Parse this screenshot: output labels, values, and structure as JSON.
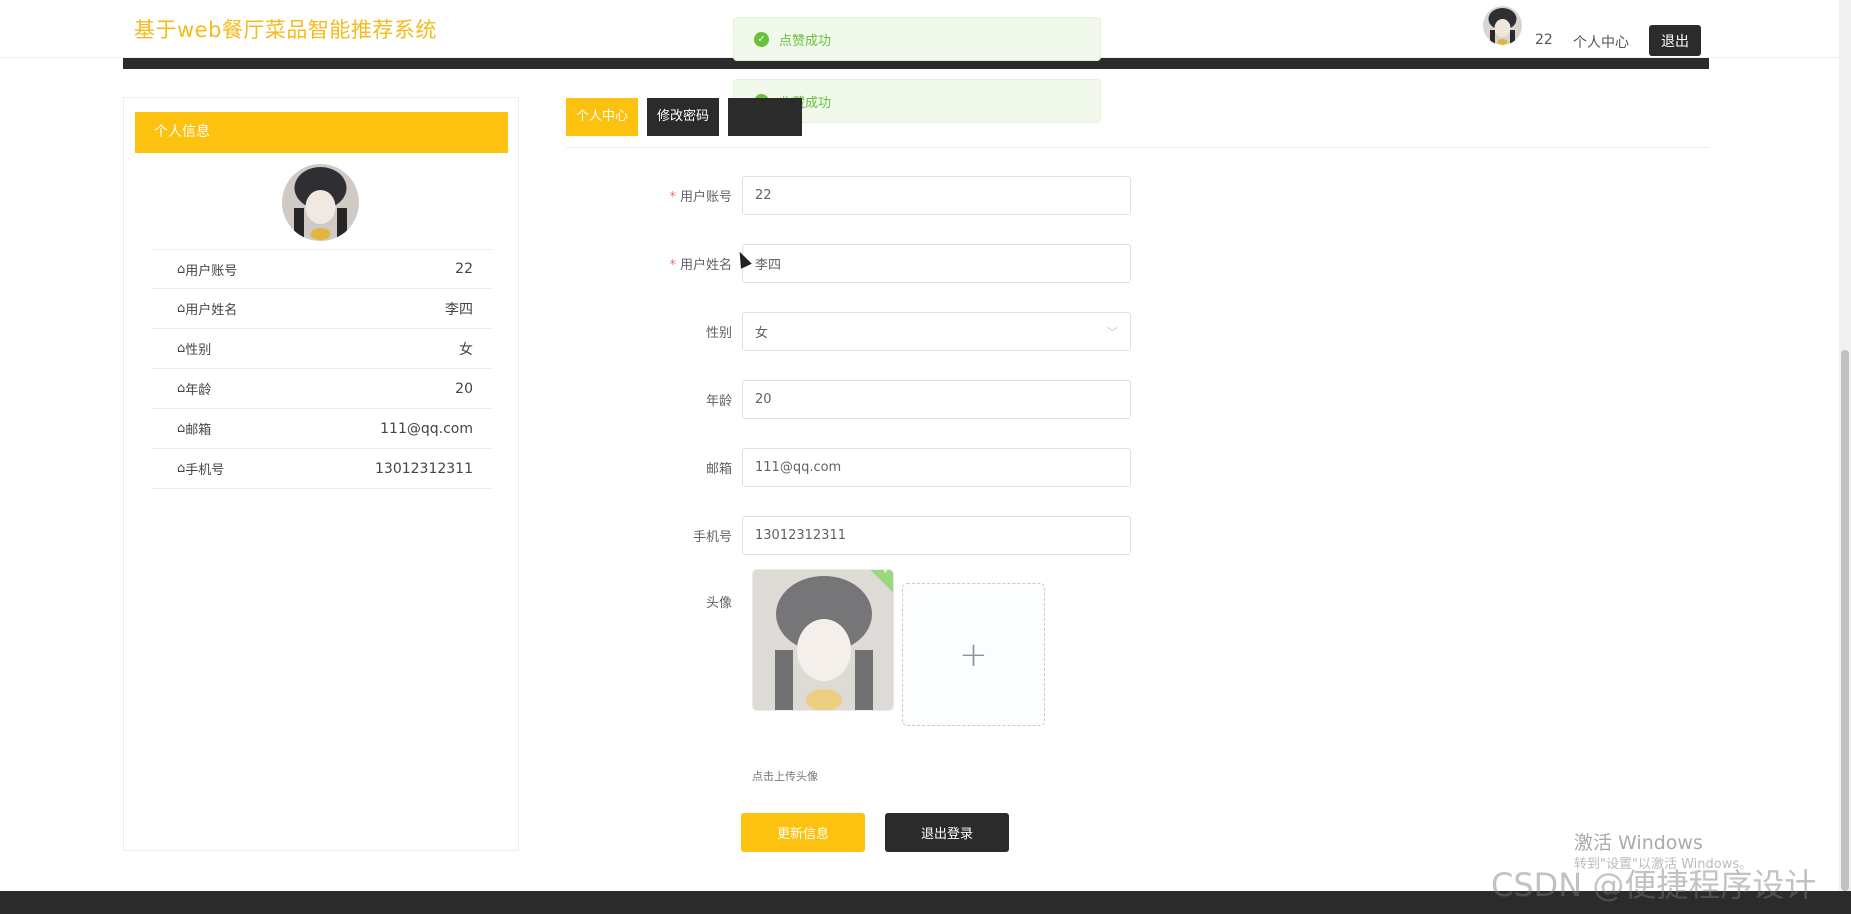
{
  "header": {
    "site_title": "基于web餐厅菜品智能推荐系统",
    "username": "22",
    "center_link": "个人中心",
    "logout_button": "退出"
  },
  "toasts": [
    {
      "text": "点赞成功",
      "type": "success"
    },
    {
      "text": "收藏成功",
      "type": "success"
    }
  ],
  "profile_panel": {
    "title": "个人信息",
    "rows": [
      {
        "label": "用户账号",
        "value": "22"
      },
      {
        "label": "用户姓名",
        "value": "李四"
      },
      {
        "label": "性别",
        "value": "女"
      },
      {
        "label": "年龄",
        "value": "20"
      },
      {
        "label": "邮箱",
        "value": "111@qq.com"
      },
      {
        "label": "手机号",
        "value": "13012312311"
      }
    ]
  },
  "tabs": [
    {
      "label": "个人中心",
      "active": true
    },
    {
      "label": "修改密码",
      "active": false
    },
    {
      "label": "",
      "active": false
    }
  ],
  "form": {
    "account": {
      "label": "用户账号",
      "value": "22",
      "required": true
    },
    "name": {
      "label": "用户姓名",
      "value": "李四",
      "required": true
    },
    "gender": {
      "label": "性别",
      "value": "女"
    },
    "age": {
      "label": "年龄",
      "value": "20"
    },
    "email": {
      "label": "邮箱",
      "value": "111@qq.com"
    },
    "phone": {
      "label": "手机号",
      "value": "13012312311"
    },
    "avatar": {
      "label": "头像",
      "upload_plus": "+",
      "tip": "点击上传头像"
    },
    "update_button": "更新信息",
    "logout_button": "退出登录"
  },
  "watermark": {
    "line1": "激活 Windows",
    "line2": "转到\"设置\"以激活 Windows。",
    "csdn": "CSDN @便捷程序设计"
  },
  "colors": {
    "accent": "#fdc20f",
    "dark": "#2b2b2b",
    "success": "#67c23a"
  }
}
